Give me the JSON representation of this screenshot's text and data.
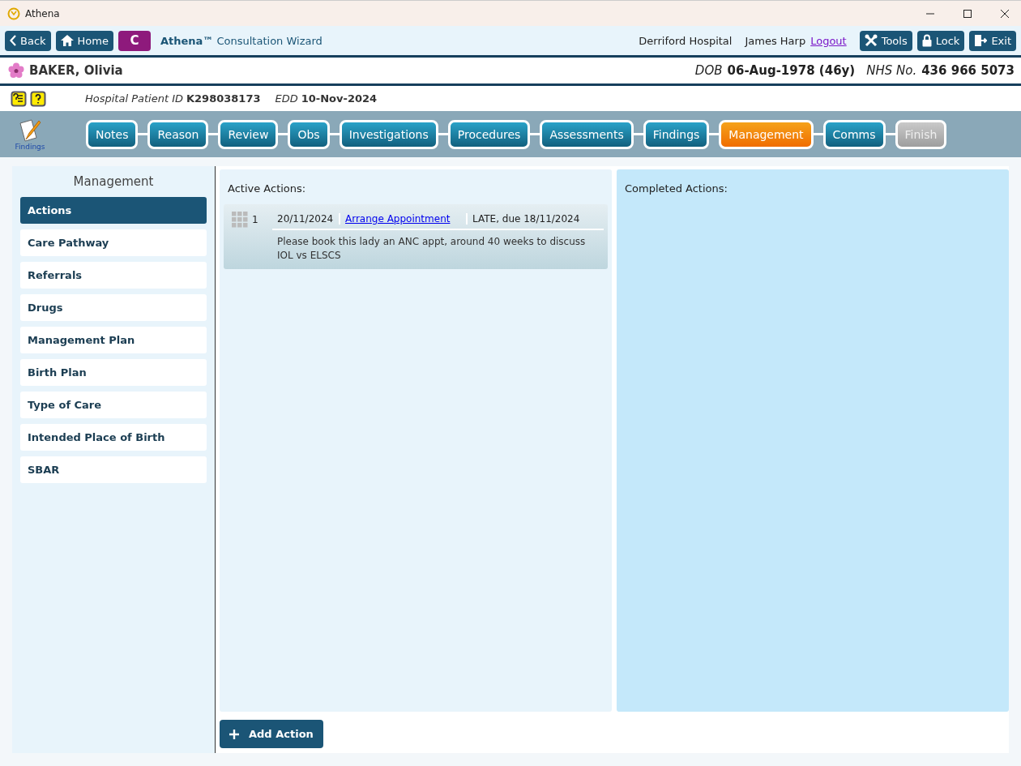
{
  "window": {
    "title": "Athena"
  },
  "nav": {
    "back": "Back",
    "home": "Home",
    "badge": "C",
    "title": "**Athena™** Consultation Wizard",
    "hospital": "Derriford Hospital",
    "user": "James Harp",
    "logout": "Logout",
    "tools": "Tools",
    "lock": "Lock",
    "exit": "Exit"
  },
  "patient": {
    "name": "BAKER, Olivia",
    "dob_label": "DOB",
    "dob": "06-Aug-1978 (46y)",
    "nhs_label": "NHS No.",
    "nhs": "436 966 5073",
    "id_label": "Hospital Patient ID",
    "id": "K298038173",
    "edd_label": "EDD",
    "edd": "10-Nov-2024"
  },
  "steps_icon_label": "Findings",
  "steps": [
    {
      "label": "Notes",
      "selected": false,
      "disabled": false
    },
    {
      "label": "Reason",
      "selected": false,
      "disabled": false
    },
    {
      "label": "Review",
      "selected": false,
      "disabled": false
    },
    {
      "label": "Obs",
      "selected": false,
      "disabled": false
    },
    {
      "label": "Investigations",
      "selected": false,
      "disabled": false
    },
    {
      "label": "Procedures",
      "selected": false,
      "disabled": false
    },
    {
      "label": "Assessments",
      "selected": false,
      "disabled": false
    },
    {
      "label": "Findings",
      "selected": false,
      "disabled": false
    },
    {
      "label": "Management",
      "selected": true,
      "disabled": false
    },
    {
      "label": "Comms",
      "selected": false,
      "disabled": false
    },
    {
      "label": "Finish",
      "selected": false,
      "disabled": true
    }
  ],
  "sidebar": {
    "title": "Management",
    "items": [
      {
        "label": "Actions",
        "selected": true
      },
      {
        "label": "Care Pathway",
        "selected": false
      },
      {
        "label": "Referrals",
        "selected": false
      },
      {
        "label": "Drugs",
        "selected": false
      },
      {
        "label": "Management Plan",
        "selected": false
      },
      {
        "label": "Birth Plan",
        "selected": false
      },
      {
        "label": "Type of Care",
        "selected": false
      },
      {
        "label": "Intended Place of Birth",
        "selected": false
      },
      {
        "label": "SBAR",
        "selected": false
      }
    ]
  },
  "active_actions": {
    "title": "Active Actions:",
    "items": [
      {
        "number": "1",
        "date": "20/11/2024",
        "action": "Arrange Appointment",
        "status": "LATE, due 18/11/2024",
        "note": "Please book this lady an ANC appt, around 40 weeks to discuss IOL vs ELSCS"
      }
    ]
  },
  "completed_actions": {
    "title": "Completed Actions:"
  },
  "add_action": "Add Action"
}
